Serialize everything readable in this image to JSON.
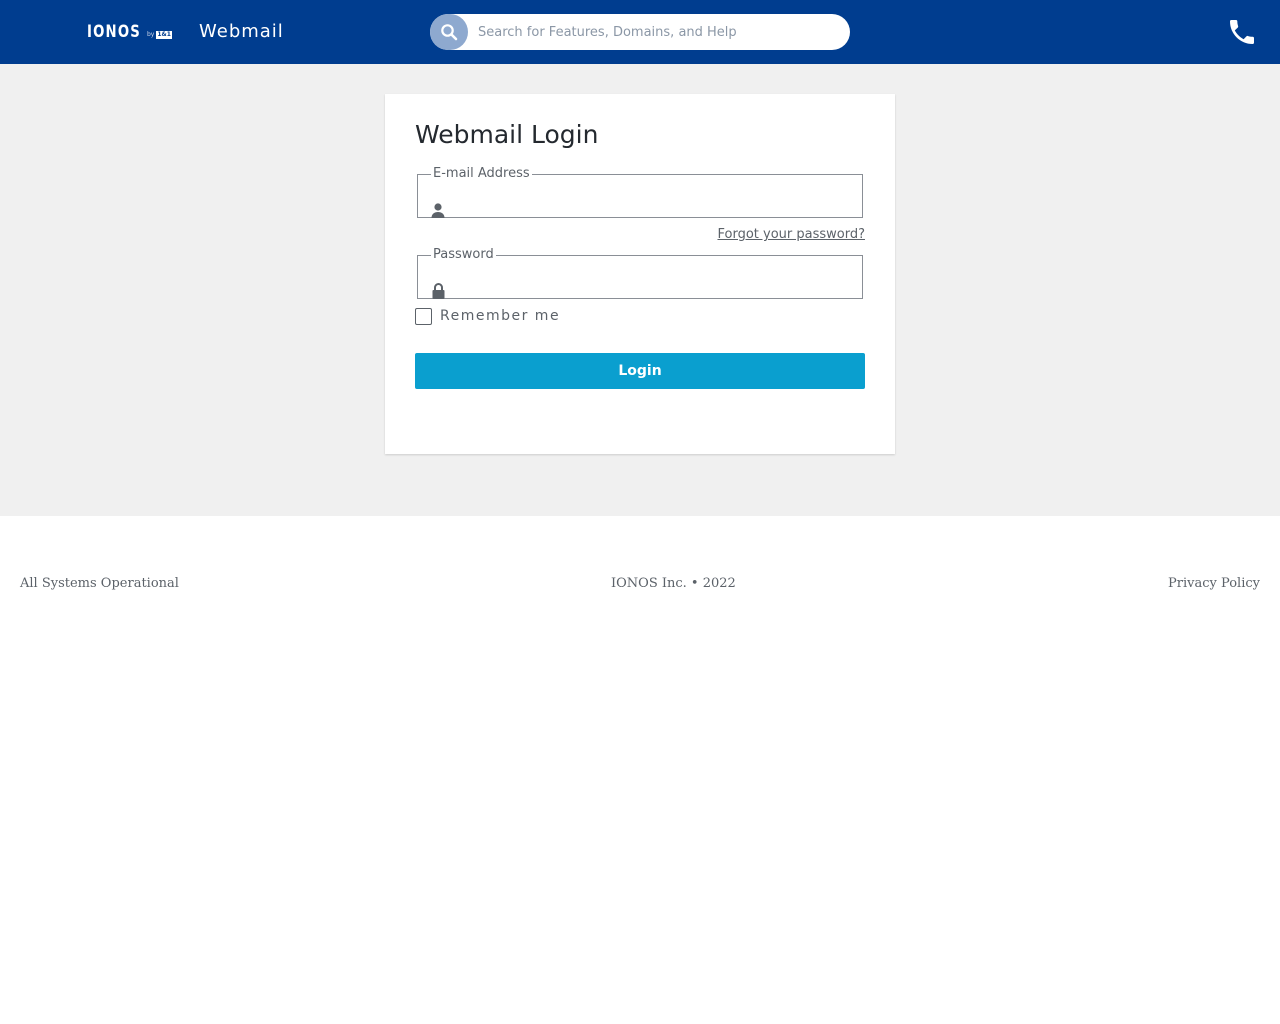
{
  "header": {
    "logo_text": "IONOS",
    "logo_by": "by",
    "logo_badge": "1&1",
    "app_title": "Webmail",
    "search_placeholder": "Search for Features, Domains, and Help",
    "search_icon": "search-icon",
    "phone_icon": "phone-icon",
    "background_color": "#003d8f"
  },
  "login": {
    "title": "Webmail Login",
    "email_label": "E-mail Address",
    "email_value": "",
    "email_icon": "user-icon",
    "forgot_label": "Forgot your password?",
    "password_label": "Password",
    "password_value": "",
    "password_icon": "lock-icon",
    "remember_label": "Remember me",
    "remember_checked": false,
    "login_label": "Login",
    "button_color": "#0a9fcf"
  },
  "footer": {
    "status": "All Systems Operational",
    "copyright": "IONOS Inc. • 2022",
    "privacy": "Privacy Policy"
  }
}
